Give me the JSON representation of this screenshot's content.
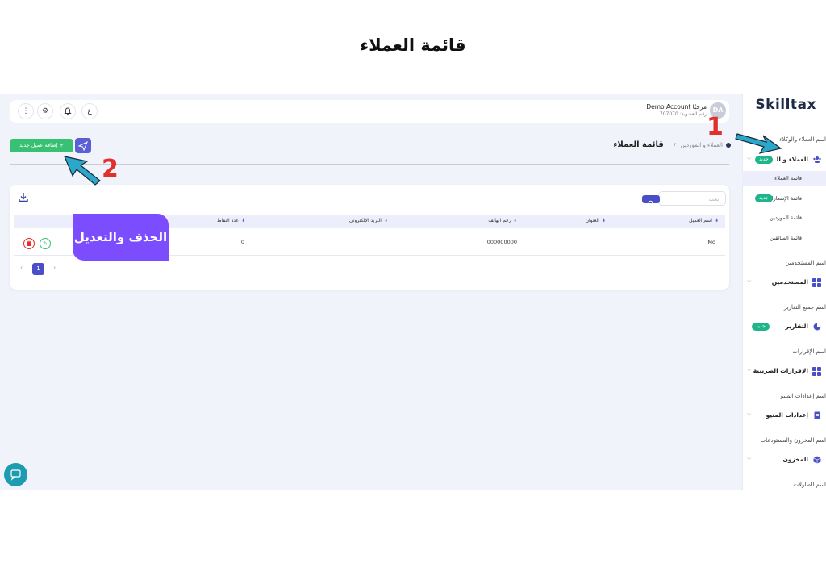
{
  "page_heading": "قائمة العملاء",
  "sidebar": {
    "logo": "Skilltax",
    "sections": [
      {
        "label": "اسم العملاء والوكلاء",
        "item": "العملاء و الـ",
        "badge": "جديد",
        "subitems": [
          "قائمة العملاء",
          "قائمة الإشعارات",
          "قائمة الموردين",
          "قائمة السائقين"
        ],
        "sub_badge": "جديد"
      },
      {
        "label": "اسم المستخدمين",
        "item": "المستخدمين"
      },
      {
        "label": "اسم جميع التقارير",
        "item": "التقارير",
        "badge": "جديد"
      },
      {
        "label": "اسم الإقرارات",
        "item": "الإقرارات الضريبية"
      },
      {
        "label": "اسم إعدادات المنيو",
        "item": "إعدادات المنيو"
      },
      {
        "label": "اسم المخزون والمستودعات",
        "item": "المخزون"
      },
      {
        "label": "اسم الطاولات"
      }
    ]
  },
  "topbar": {
    "avatar": "DA",
    "greeting": "مرحبًا Demo Account",
    "subline": "رقم العضوية: 707070"
  },
  "breadcrumb": {
    "parent": "العملاء و الموردين",
    "separator": "/",
    "current": "قائمة العملاء"
  },
  "add_button": "+ إضافة عميل جديد",
  "search": {
    "placeholder": "بحث"
  },
  "table": {
    "headers": [
      "اسم العميل",
      "العنوان",
      "رقم الهاتف",
      "البريد الإلكتروني",
      "عدد النقاط"
    ],
    "rows": [
      {
        "name": "Mo",
        "address": "",
        "phone": "000000000",
        "email": "",
        "points": "0"
      }
    ]
  },
  "pagination": {
    "current": "1"
  },
  "callouts": {
    "edit_delete": "الحذف والتعديل",
    "marker_1": "1",
    "marker_2": "2"
  },
  "colors": {
    "primary": "#4b4fc7",
    "add_button": "#38c172",
    "badge": "#1fb58a",
    "callout": "#7c4dff",
    "marker": "#e0302b",
    "arrow": "#2aa7c9"
  }
}
